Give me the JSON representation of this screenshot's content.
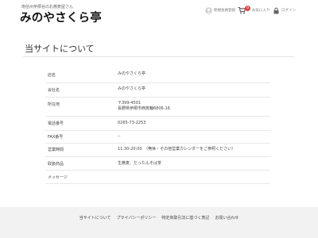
{
  "header": {
    "tagline": "南信州伊那谷のお蕎麦屋さん",
    "logo": "みのやさくら亭",
    "utility": {
      "register": "新規会員登録",
      "cart_count": "0",
      "favorites": "お気に入り",
      "login": "ログイン"
    }
  },
  "page_title": "当サイトについて",
  "info_rows": [
    {
      "label": "店名",
      "value": "みのやさくら亭"
    },
    {
      "label": "会社名",
      "value": "みのやさくら亭"
    },
    {
      "label": "所在地",
      "value": "〒399-4501",
      "value2": "長野県伊那市西箕輪6806-16"
    },
    {
      "label": "電話番号",
      "value": "0265-73-2253"
    },
    {
      "label": "FAX番号",
      "value": "--"
    },
    {
      "label": "営業時間",
      "value": "11:30-20:00　（無休・その他営業カレンダーをご参照ください）"
    },
    {
      "label": "取扱商品",
      "value": "生蕎麦、だったんそば茶"
    },
    {
      "label": "メッセージ",
      "value": ""
    }
  ],
  "footer": {
    "links": [
      "当サイトについて",
      "プライバシーポリシー",
      "特定商取引法に基づく表記",
      "お問い合わせ"
    ]
  },
  "colors": {
    "badge": "#dd4444",
    "footer_bg": "#f2f2f2"
  }
}
